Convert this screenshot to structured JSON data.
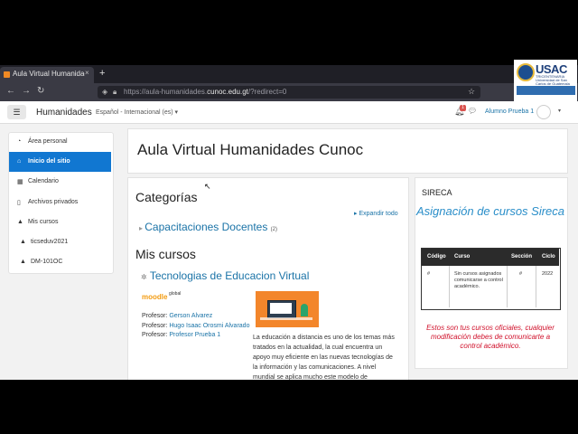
{
  "browser": {
    "tab_title": "Aula Virtual Humanidades",
    "tab_close": "×",
    "new_tab": "+",
    "url_prefix": "https://aula-humanidades.",
    "url_host": "cunoc.edu.gt",
    "url_suffix": "/?redirect=0"
  },
  "logo": {
    "name": "USAC",
    "subtitle": "TRICENTENARIA Universidad de San Carlos de Guatemala"
  },
  "header": {
    "site_name": "Humanidades",
    "language": "Español - Internacional (es)",
    "notification_count": "1",
    "user_name": "Alumno Prueba 1"
  },
  "sidebar": {
    "items": [
      {
        "label": "Área personal",
        "icon": "dashboard-icon"
      },
      {
        "label": "Inicio del sitio",
        "icon": "home-icon"
      },
      {
        "label": "Calendario",
        "icon": "calendar-icon"
      },
      {
        "label": "Archivos privados",
        "icon": "file-icon"
      },
      {
        "label": "Mis cursos",
        "icon": "graduation-cap-icon"
      },
      {
        "label": "ticseduv2021",
        "icon": "graduation-cap-icon"
      },
      {
        "label": "DM-101OC",
        "icon": "graduation-cap-icon"
      }
    ]
  },
  "main": {
    "page_title": "Aula Virtual Humanidades Cunoc",
    "categories_heading": "Categorías",
    "expand_all": "Expandir todo",
    "category_name": "Capacitaciones Docentes",
    "category_count": "(2)",
    "my_courses_heading": "Mis cursos",
    "course_name": "Tecnologias de Educacion Virtual",
    "moodle_logo_text": "moodle",
    "moodle_logo_sub": "global",
    "teachers": [
      {
        "role": "Profesor:",
        "name": "Gerson Alvarez"
      },
      {
        "role": "Profesor:",
        "name": "Hugo Isaac Orosmi Alvarado"
      },
      {
        "role": "Profesor:",
        "name": "Profesor Prueba 1"
      }
    ],
    "description": "La educación a distancia es uno de los temas más tratados en la actualidad, la cual encuentra un apoyo muy eficiente en las nuevas tecnologías de la información y las comunicaciones. A nivel mundial se aplica mucho este modelo de"
  },
  "sireca": {
    "heading": "SIRECA",
    "title": "Asignación de cursos Sireca",
    "columns": [
      "Código",
      "Curso",
      "Sección",
      "Ciclo"
    ],
    "row": [
      "#",
      "Sin cursos asignados comunicarse a control académico.",
      "#",
      "2022"
    ],
    "note": "Estos son tus cursos oficiales, cualquier modificación debes de comunicarte a control académico."
  },
  "colors": {
    "link": "#1a73a7",
    "active": "#1177d1",
    "sireca_title": "#2a8ec9",
    "note": "#d0112b"
  }
}
